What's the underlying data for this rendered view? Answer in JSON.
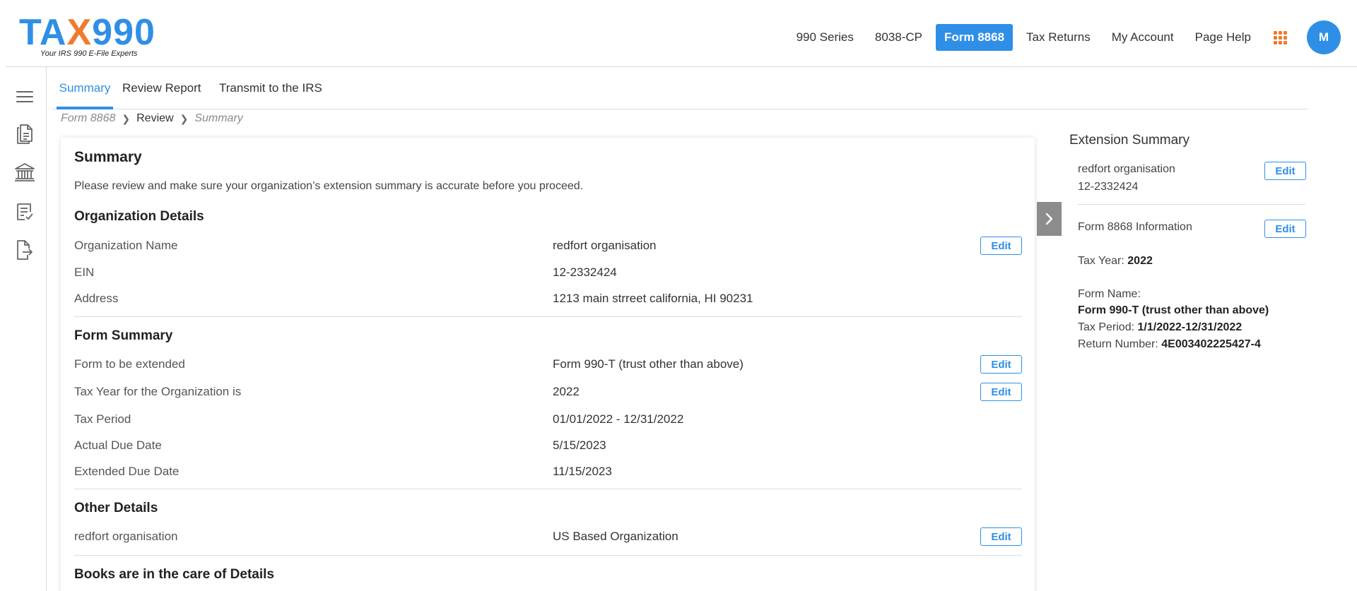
{
  "brand": {
    "logo_prefix": "TA",
    "logo_x": "X",
    "logo_suffix": "990",
    "tagline": "Your IRS 990 E-File Experts",
    "primary_color": "#2f8fe6",
    "accent_color": "#ef7b2d"
  },
  "nav": {
    "items": [
      "990 Series",
      "8038-CP",
      "Form 8868",
      "Tax Returns",
      "My Account",
      "Page Help"
    ],
    "active": "Form 8868",
    "avatar_initial": "M"
  },
  "sidebar": {
    "icons": [
      "menu-icon",
      "document-list-icon",
      "bank-icon",
      "checklist-icon",
      "file-export-icon"
    ]
  },
  "tabs": {
    "items": [
      "Summary",
      "Review Report",
      "Transmit to the IRS"
    ],
    "active": "Summary"
  },
  "breadcrumb": [
    "Form 8868",
    "Review",
    "Summary"
  ],
  "summary": {
    "title": "Summary",
    "description": "Please review and make sure your organization’s extension summary is accurate before you proceed.",
    "edit_label": "Edit",
    "sections": [
      {
        "title": "Organization Details",
        "rows": [
          {
            "label": "Organization Name",
            "value": "redfort organisation"
          },
          {
            "label": "EIN",
            "value": "12-2332424"
          },
          {
            "label": "Address",
            "value": "1213 main strreet california, HI 90231"
          }
        ]
      },
      {
        "title": "Form Summary",
        "rows": [
          {
            "label": "Form to be extended",
            "value": "Form 990-T (trust other than above)"
          },
          {
            "label": "Tax Year for the Organization is",
            "value": "2022"
          },
          {
            "label": "Tax Period",
            "value": "01/01/2022 - 12/31/2022"
          },
          {
            "label": "Actual Due Date",
            "value": "5/15/2023"
          },
          {
            "label": "Extended Due Date",
            "value": "11/15/2023"
          }
        ]
      },
      {
        "title": "Other Details",
        "rows": [
          {
            "label": "redfort organisation",
            "value": "US Based Organization"
          }
        ]
      },
      {
        "title": "Books are in the care of Details",
        "rows": []
      }
    ]
  },
  "extension_panel": {
    "title": "Extension Summary",
    "org_name": "redfort organisation",
    "org_ein": "12-2332424",
    "form_info_title": "Form 8868 Information",
    "tax_year_label": "Tax Year:",
    "tax_year_value": "2022",
    "form_name_label": "Form Name:",
    "form_name_value": "Form 990-T (trust other than above)",
    "tax_period_label": "Tax Period:",
    "tax_period_value": "1/1/2022-12/31/2022",
    "return_number_label": "Return Number:",
    "return_number_value": "4E003402225427-4",
    "edit_label": "Edit"
  }
}
